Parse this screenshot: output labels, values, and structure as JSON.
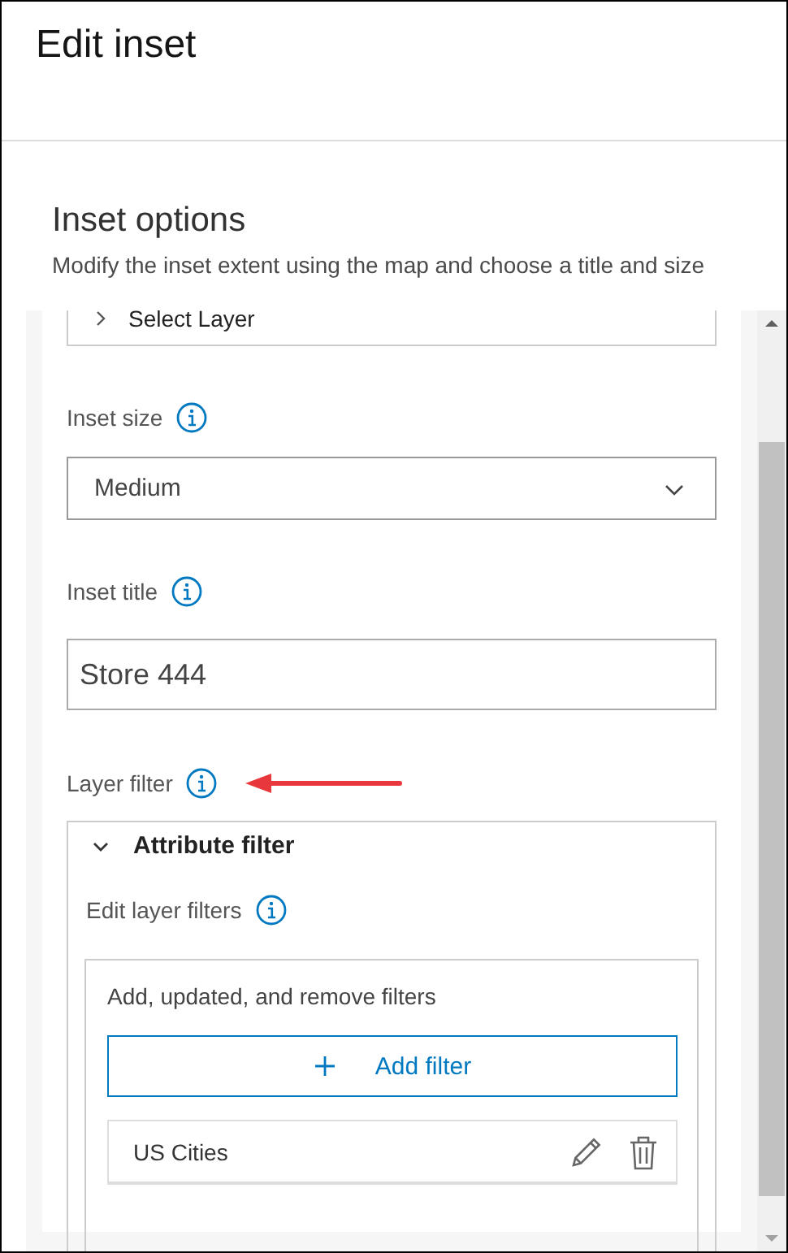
{
  "header": {
    "title": "Edit inset"
  },
  "section": {
    "title": "Inset options",
    "description": "Modify the inset extent using the map and choose a title and size"
  },
  "select_layer": {
    "label": "Select Layer",
    "expanded": false
  },
  "fields": [
    {
      "kind": "select",
      "label": "Inset size",
      "value": "Medium"
    },
    {
      "kind": "text",
      "label": "Inset title",
      "value": "Store 444"
    }
  ],
  "layer_filter": {
    "label": "Layer filter"
  },
  "attribute_filter": {
    "label": "Attribute filter",
    "expanded": true,
    "sublabel": "Edit layer filters",
    "hint": "Add, updated, and remove filters",
    "add_button": "Add filter",
    "filters": [
      {
        "name": "US Cities"
      }
    ]
  }
}
